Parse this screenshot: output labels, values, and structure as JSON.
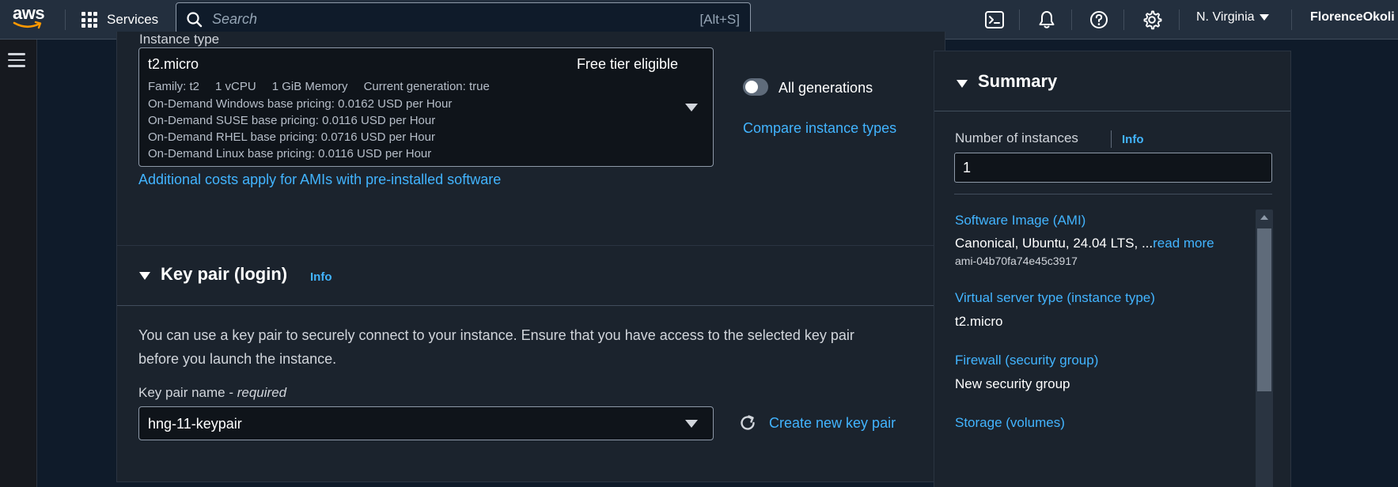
{
  "topnav": {
    "logo_text": "aws",
    "services_label": "Services",
    "search_placeholder": "Search",
    "search_shortcut": "[Alt+S]",
    "icons": [
      "cloudshell-icon",
      "notifications-icon",
      "help-icon",
      "settings-icon"
    ],
    "region": "N. Virginia",
    "user": "FlorenceOkoli @"
  },
  "instance_type": {
    "label": "Instance type",
    "selected": {
      "name": "t2.micro",
      "badge": "Free tier eligible",
      "family": "Family: t2",
      "vcpu": "1 vCPU",
      "memory": "1 GiB Memory",
      "generation": "Current generation: true",
      "pricing": [
        "On-Demand Windows base pricing: 0.0162 USD per Hour",
        "On-Demand SUSE base pricing: 0.0116 USD per Hour",
        "On-Demand RHEL base pricing: 0.0716 USD per Hour",
        "On-Demand Linux base pricing: 0.0116 USD per Hour"
      ]
    },
    "all_generations_label": "All generations",
    "all_generations_on": false,
    "compare_link": "Compare instance types",
    "additional_costs_link": "Additional costs apply for AMIs with pre-installed software"
  },
  "key_pair": {
    "title": "Key pair (login)",
    "info": "Info",
    "description": "You can use a key pair to securely connect to your instance. Ensure that you have access to the selected key pair before you launch the instance.",
    "name_label": "Key pair name - ",
    "name_required": "required",
    "selected": "hng-11-keypair",
    "create_link": "Create new key pair"
  },
  "summary": {
    "title": "Summary",
    "num_instances_label": "Number of instances",
    "info": "Info",
    "num_instances_value": "1",
    "ami_link": "Software Image (AMI)",
    "ami_value": "Canonical, Ubuntu, 24.04 LTS, ...",
    "ami_read_more": "read more",
    "ami_id": "ami-04b70fa74e45c3917",
    "instance_type_link": "Virtual server type (instance type)",
    "instance_type_value": "t2.micro",
    "firewall_link": "Firewall (security group)",
    "firewall_value": "New security group",
    "storage_link": "Storage (volumes)"
  },
  "colors": {
    "nav_bg": "#232f3e",
    "panel_bg": "#1b232d",
    "page_bg": "#0f1b2a",
    "link": "#42b4ff"
  }
}
